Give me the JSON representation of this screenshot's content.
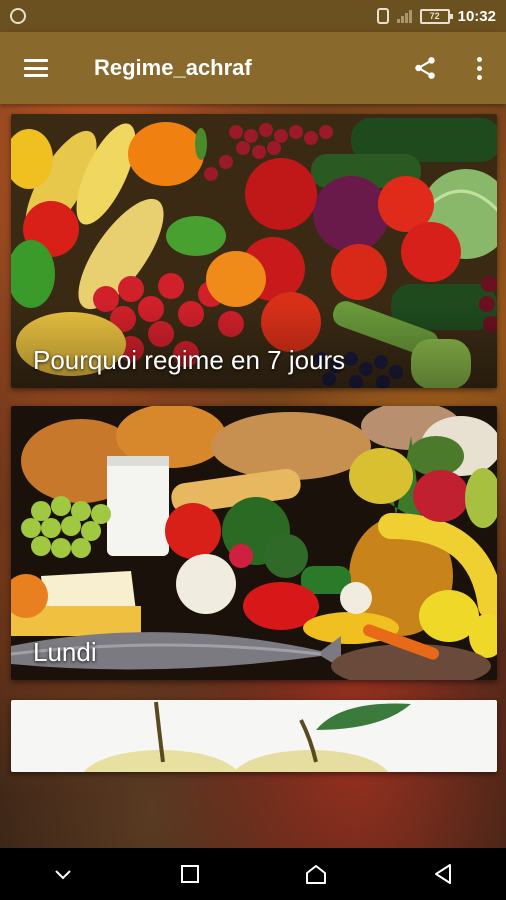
{
  "status_bar": {
    "battery_level": "72",
    "time": "10:32"
  },
  "app_bar": {
    "title": "Regime_achraf",
    "menu_icon": "hamburger-menu-icon",
    "share_icon": "share-icon",
    "more_icon": "more-vert-icon"
  },
  "cards": [
    {
      "label": "Pourquoi regime en 7 jours",
      "image": "vegetables-photo"
    },
    {
      "label": "Lundi",
      "image": "food-assortment-photo"
    },
    {
      "label": "",
      "image": "apples-photo"
    }
  ],
  "nav_bar": {
    "icons": [
      "chevron-down-icon",
      "recents-square-icon",
      "home-icon",
      "back-triangle-icon"
    ]
  },
  "colors": {
    "status_bar": "#6b5020",
    "app_bar": "#8a6a2c",
    "nav_bar": "#000000"
  }
}
